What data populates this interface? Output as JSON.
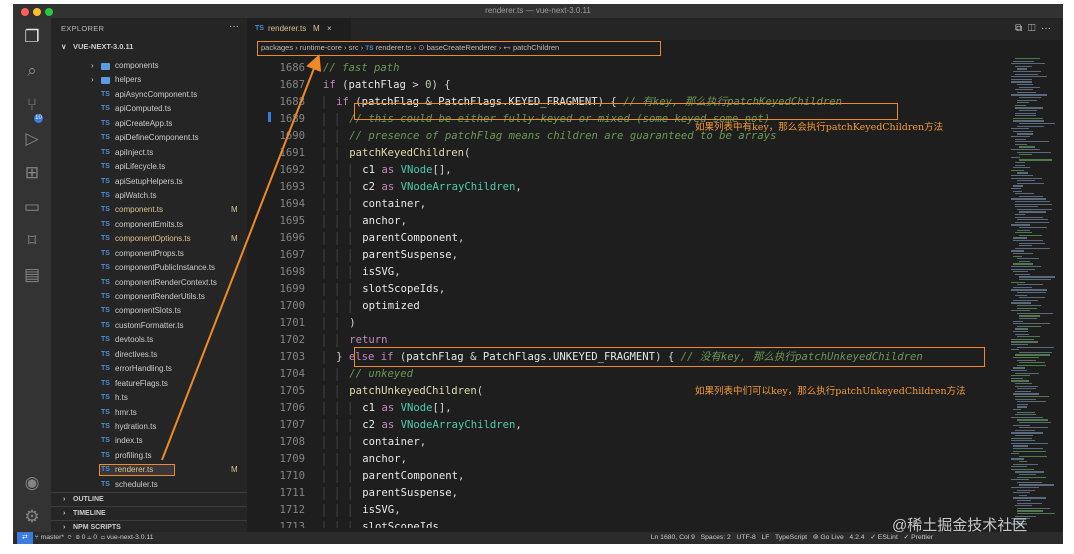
{
  "window": {
    "title": "renderer.ts — vue-next-3.0.11"
  },
  "colors": {
    "accent": "#f08a24",
    "annotation": "#f59b3b",
    "modified": "#e2c08d",
    "ts_icon": "#4a8fd6"
  },
  "activity_bar": {
    "icons": [
      "files-icon",
      "search-icon",
      "source-control-icon",
      "run-debug-icon",
      "extensions-icon",
      "remote-explorer-icon",
      "bookmarks-icon",
      "folder-icon",
      "account-icon",
      "settings-icon"
    ],
    "badge": "10"
  },
  "sidebar": {
    "title": "EXPLORER",
    "more": "···",
    "root": "VUE-NEXT-3.0.11",
    "items": [
      {
        "type": "folder",
        "name": "components",
        "mod": ""
      },
      {
        "type": "folder",
        "name": "helpers",
        "mod": ""
      },
      {
        "type": "file",
        "name": "apiAsyncComponent.ts",
        "mod": ""
      },
      {
        "type": "file",
        "name": "apiComputed.ts",
        "mod": ""
      },
      {
        "type": "file",
        "name": "apiCreateApp.ts",
        "mod": ""
      },
      {
        "type": "file",
        "name": "apiDefineComponent.ts",
        "mod": ""
      },
      {
        "type": "file",
        "name": "apiInject.ts",
        "mod": ""
      },
      {
        "type": "file",
        "name": "apiLifecycle.ts",
        "mod": ""
      },
      {
        "type": "file",
        "name": "apiSetupHelpers.ts",
        "mod": ""
      },
      {
        "type": "file",
        "name": "apiWatch.ts",
        "mod": ""
      },
      {
        "type": "file",
        "name": "component.ts",
        "mod": "M"
      },
      {
        "type": "file",
        "name": "componentEmits.ts",
        "mod": ""
      },
      {
        "type": "file",
        "name": "componentOptions.ts",
        "mod": "M"
      },
      {
        "type": "file",
        "name": "componentProps.ts",
        "mod": ""
      },
      {
        "type": "file",
        "name": "componentPublicInstance.ts",
        "mod": ""
      },
      {
        "type": "file",
        "name": "componentRenderContext.ts",
        "mod": ""
      },
      {
        "type": "file",
        "name": "componentRenderUtils.ts",
        "mod": ""
      },
      {
        "type": "file",
        "name": "componentSlots.ts",
        "mod": ""
      },
      {
        "type": "file",
        "name": "customFormatter.ts",
        "mod": ""
      },
      {
        "type": "file",
        "name": "devtools.ts",
        "mod": ""
      },
      {
        "type": "file",
        "name": "directives.ts",
        "mod": ""
      },
      {
        "type": "file",
        "name": "errorHandling.ts",
        "mod": ""
      },
      {
        "type": "file",
        "name": "featureFlags.ts",
        "mod": ""
      },
      {
        "type": "file",
        "name": "h.ts",
        "mod": ""
      },
      {
        "type": "file",
        "name": "hmr.ts",
        "mod": ""
      },
      {
        "type": "file",
        "name": "hydration.ts",
        "mod": ""
      },
      {
        "type": "file",
        "name": "index.ts",
        "mod": ""
      },
      {
        "type": "file",
        "name": "profiling.ts",
        "mod": ""
      },
      {
        "type": "file",
        "name": "renderer.ts",
        "mod": "M",
        "selected": true
      },
      {
        "type": "file",
        "name": "scheduler.ts",
        "mod": ""
      }
    ],
    "sections": [
      "OUTLINE",
      "TIMELINE",
      "NPM SCRIPTS"
    ]
  },
  "editor": {
    "tab": {
      "icon": "TS",
      "name": "renderer.ts",
      "modified": "M",
      "close": "×"
    },
    "tab_actions": [
      "⧉",
      "◫",
      "···"
    ],
    "breadcrumb": [
      "packages",
      "runtime-core",
      "src",
      "renderer.ts",
      "baseCreateRenderer",
      "patchChildren"
    ],
    "lines": [
      {
        "n": "1686",
        "tokens": [
          [
            "cm",
            "// fast path"
          ]
        ],
        "indent": 2
      },
      {
        "n": "1687",
        "tokens": [
          [
            "kw",
            "if"
          ],
          [
            "pu",
            " ("
          ],
          [
            "vr",
            "patchFlag"
          ],
          [
            "pu",
            " > "
          ],
          [
            "nm",
            "0"
          ],
          [
            "pu",
            ") {"
          ]
        ],
        "indent": 2
      },
      {
        "n": "1688",
        "tokens": [
          [
            "kw",
            "if"
          ],
          [
            "pu",
            " ("
          ],
          [
            "vr",
            "patchFlag"
          ],
          [
            "pu",
            " & "
          ],
          [
            "vr",
            "PatchFlags"
          ],
          [
            "pu",
            "."
          ],
          [
            "vr",
            "KEYED_FRAGMENT"
          ],
          [
            "pu",
            ") { "
          ],
          [
            "cm",
            "// 有key, 那么执行patchKeyedChildren"
          ]
        ],
        "indent": 3
      },
      {
        "n": "1689",
        "tokens": [
          [
            "cm",
            "// this could be either fully-keyed or mixed (some keyed some not)"
          ]
        ],
        "indent": 4
      },
      {
        "n": "1690",
        "tokens": [
          [
            "cm",
            "// presence of patchFlag means children are guaranteed to be arrays"
          ]
        ],
        "indent": 4
      },
      {
        "n": "1691",
        "tokens": [
          [
            "fn",
            "patchKeyedChildren"
          ],
          [
            "pu",
            "("
          ]
        ],
        "indent": 4
      },
      {
        "n": "1692",
        "tokens": [
          [
            "vr",
            "c1"
          ],
          [
            "pu",
            " "
          ],
          [
            "kw",
            "as"
          ],
          [
            "pu",
            " "
          ],
          [
            "ty",
            "VNode"
          ],
          [
            "pu",
            "[],"
          ]
        ],
        "indent": 5
      },
      {
        "n": "1693",
        "tokens": [
          [
            "vr",
            "c2"
          ],
          [
            "pu",
            " "
          ],
          [
            "kw",
            "as"
          ],
          [
            "pu",
            " "
          ],
          [
            "ty",
            "VNodeArrayChildren"
          ],
          [
            "pu",
            ","
          ]
        ],
        "indent": 5
      },
      {
        "n": "1694",
        "tokens": [
          [
            "vr",
            "container"
          ],
          [
            "pu",
            ","
          ]
        ],
        "indent": 5
      },
      {
        "n": "1695",
        "tokens": [
          [
            "vr",
            "anchor"
          ],
          [
            "pu",
            ","
          ]
        ],
        "indent": 5
      },
      {
        "n": "1696",
        "tokens": [
          [
            "vr",
            "parentComponent"
          ],
          [
            "pu",
            ","
          ]
        ],
        "indent": 5
      },
      {
        "n": "1697",
        "tokens": [
          [
            "vr",
            "parentSuspense"
          ],
          [
            "pu",
            ","
          ]
        ],
        "indent": 5
      },
      {
        "n": "1698",
        "tokens": [
          [
            "vr",
            "isSVG"
          ],
          [
            "pu",
            ","
          ]
        ],
        "indent": 5
      },
      {
        "n": "1699",
        "tokens": [
          [
            "vr",
            "slotScopeIds"
          ],
          [
            "pu",
            ","
          ]
        ],
        "indent": 5
      },
      {
        "n": "1700",
        "tokens": [
          [
            "vr",
            "optimized"
          ]
        ],
        "indent": 5
      },
      {
        "n": "1701",
        "tokens": [
          [
            "pu",
            ")"
          ]
        ],
        "indent": 4
      },
      {
        "n": "1702",
        "tokens": [
          [
            "kw",
            "return"
          ]
        ],
        "indent": 4
      },
      {
        "n": "1703",
        "tokens": [
          [
            "pu",
            "} "
          ],
          [
            "kw",
            "else if"
          ],
          [
            "pu",
            " ("
          ],
          [
            "vr",
            "patchFlag"
          ],
          [
            "pu",
            " & "
          ],
          [
            "vr",
            "PatchFlags"
          ],
          [
            "pu",
            "."
          ],
          [
            "vr",
            "UNKEYED_FRAGMENT"
          ],
          [
            "pu",
            ") { "
          ],
          [
            "cm",
            "// 没有key, 那么执行patchUnkeyedChildren"
          ]
        ],
        "indent": 3
      },
      {
        "n": "1704",
        "tokens": [
          [
            "cm",
            "// unkeyed"
          ]
        ],
        "indent": 4
      },
      {
        "n": "1705",
        "tokens": [
          [
            "fn",
            "patchUnkeyedChildren"
          ],
          [
            "pu",
            "("
          ]
        ],
        "indent": 4
      },
      {
        "n": "1706",
        "tokens": [
          [
            "vr",
            "c1"
          ],
          [
            "pu",
            " "
          ],
          [
            "kw",
            "as"
          ],
          [
            "pu",
            " "
          ],
          [
            "ty",
            "VNode"
          ],
          [
            "pu",
            "[],"
          ]
        ],
        "indent": 5
      },
      {
        "n": "1707",
        "tokens": [
          [
            "vr",
            "c2"
          ],
          [
            "pu",
            " "
          ],
          [
            "kw",
            "as"
          ],
          [
            "pu",
            " "
          ],
          [
            "ty",
            "VNodeArrayChildren"
          ],
          [
            "pu",
            ","
          ]
        ],
        "indent": 5
      },
      {
        "n": "1708",
        "tokens": [
          [
            "vr",
            "container"
          ],
          [
            "pu",
            ","
          ]
        ],
        "indent": 5
      },
      {
        "n": "1709",
        "tokens": [
          [
            "vr",
            "anchor"
          ],
          [
            "pu",
            ","
          ]
        ],
        "indent": 5
      },
      {
        "n": "1710",
        "tokens": [
          [
            "vr",
            "parentComponent"
          ],
          [
            "pu",
            ","
          ]
        ],
        "indent": 5
      },
      {
        "n": "1711",
        "tokens": [
          [
            "vr",
            "parentSuspense"
          ],
          [
            "pu",
            ","
          ]
        ],
        "indent": 5
      },
      {
        "n": "1712",
        "tokens": [
          [
            "vr",
            "isSVG"
          ],
          [
            "pu",
            ","
          ]
        ],
        "indent": 5
      },
      {
        "n": "1713",
        "tokens": [
          [
            "vr",
            "slotScopeIds"
          ],
          [
            "pu",
            ","
          ]
        ],
        "indent": 5
      }
    ]
  },
  "annotations": {
    "keyed": "如果列表中有key，那么会执行patchKeyedChildren方法",
    "unkeyed": "如果列表中们可以key，那么执行patchUnkeyedChildren方法"
  },
  "statusbar": {
    "remote": "⇄",
    "branch": "master*",
    "sync": "⟳",
    "problems": "⊗ 0 ⚠ 0",
    "project": "vue-next-3.0.11",
    "position": "Ln 1680, Col 9",
    "spaces": "Spaces: 2",
    "encoding": "UTF-8",
    "eol": "LF",
    "language": "TypeScript",
    "golive": "Go Live",
    "version": "4.2.4",
    "eslint": "✓ ESLint",
    "prettier": "✓ Prettier"
  },
  "watermark": "@稀土掘金技术社区"
}
